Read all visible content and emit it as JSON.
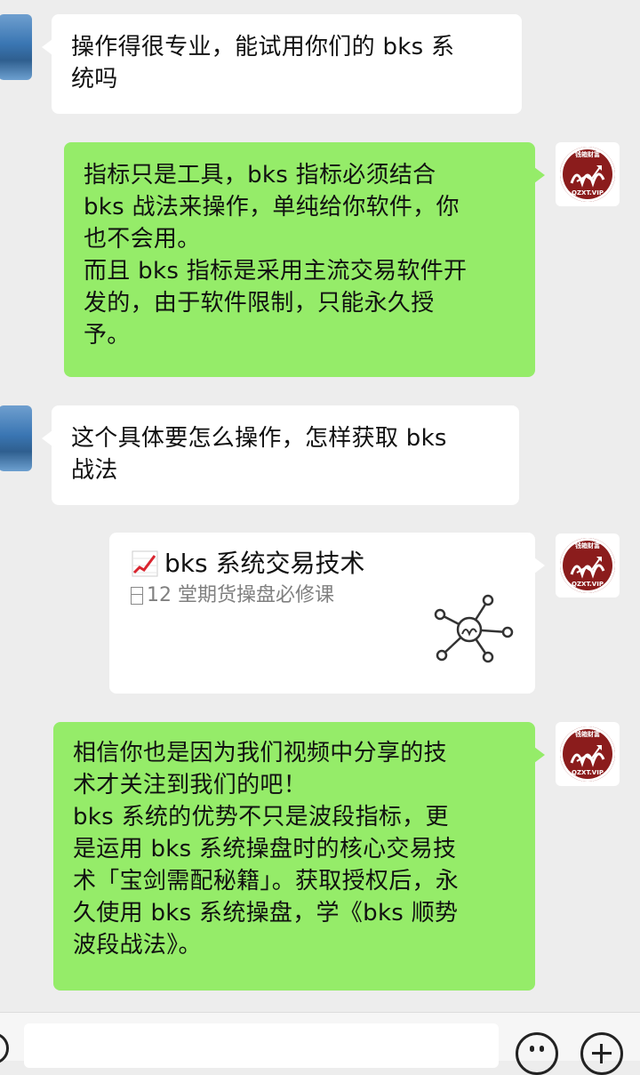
{
  "messages": [
    {
      "side": "in",
      "text": [
        "操作得很专业，能试用你们的 bks 系",
        "统吗"
      ]
    },
    {
      "side": "out",
      "text": [
        "指标只是工具，bks 指标必须结合",
        "bks 战法来操作，单纯给你软件，你",
        "也不会用。",
        "而且 bks 指标是采用主流交易软件开",
        "发的，由于软件限制，只能永久授",
        "予。"
      ]
    },
    {
      "side": "in",
      "text": [
        "这个具体要怎么操作，怎样获取 bks",
        "战法"
      ]
    },
    {
      "side": "out",
      "type": "card",
      "title": "bks 系统交易技术",
      "description": "12 堂期货操盘必修课",
      "icon": "chart-up-icon"
    },
    {
      "side": "out",
      "text": [
        "相信你也是因为我们视频中分享的技",
        "术才关注到我们的吧！",
        "bks 系统的优势不只是波段指标，更",
        "是运用 bks 系统操盘时的核心交易技",
        "术「宝剑需配秘籍」。获取授权后，永",
        "久使用 bks 系统操盘，学《bks 顺势",
        "波段战法》。"
      ]
    }
  ],
  "brand_avatar": {
    "top_text": "钱箱财富",
    "bottom_text": "QZXT.VIP"
  },
  "colors": {
    "out_bubble": "#95ec69",
    "in_bubble": "#ffffff",
    "background": "#ededed",
    "brand": "#8b1c1c"
  },
  "input_bar": {
    "icons": [
      "voice-icon",
      "emoji-icon",
      "plus-icon"
    ]
  }
}
